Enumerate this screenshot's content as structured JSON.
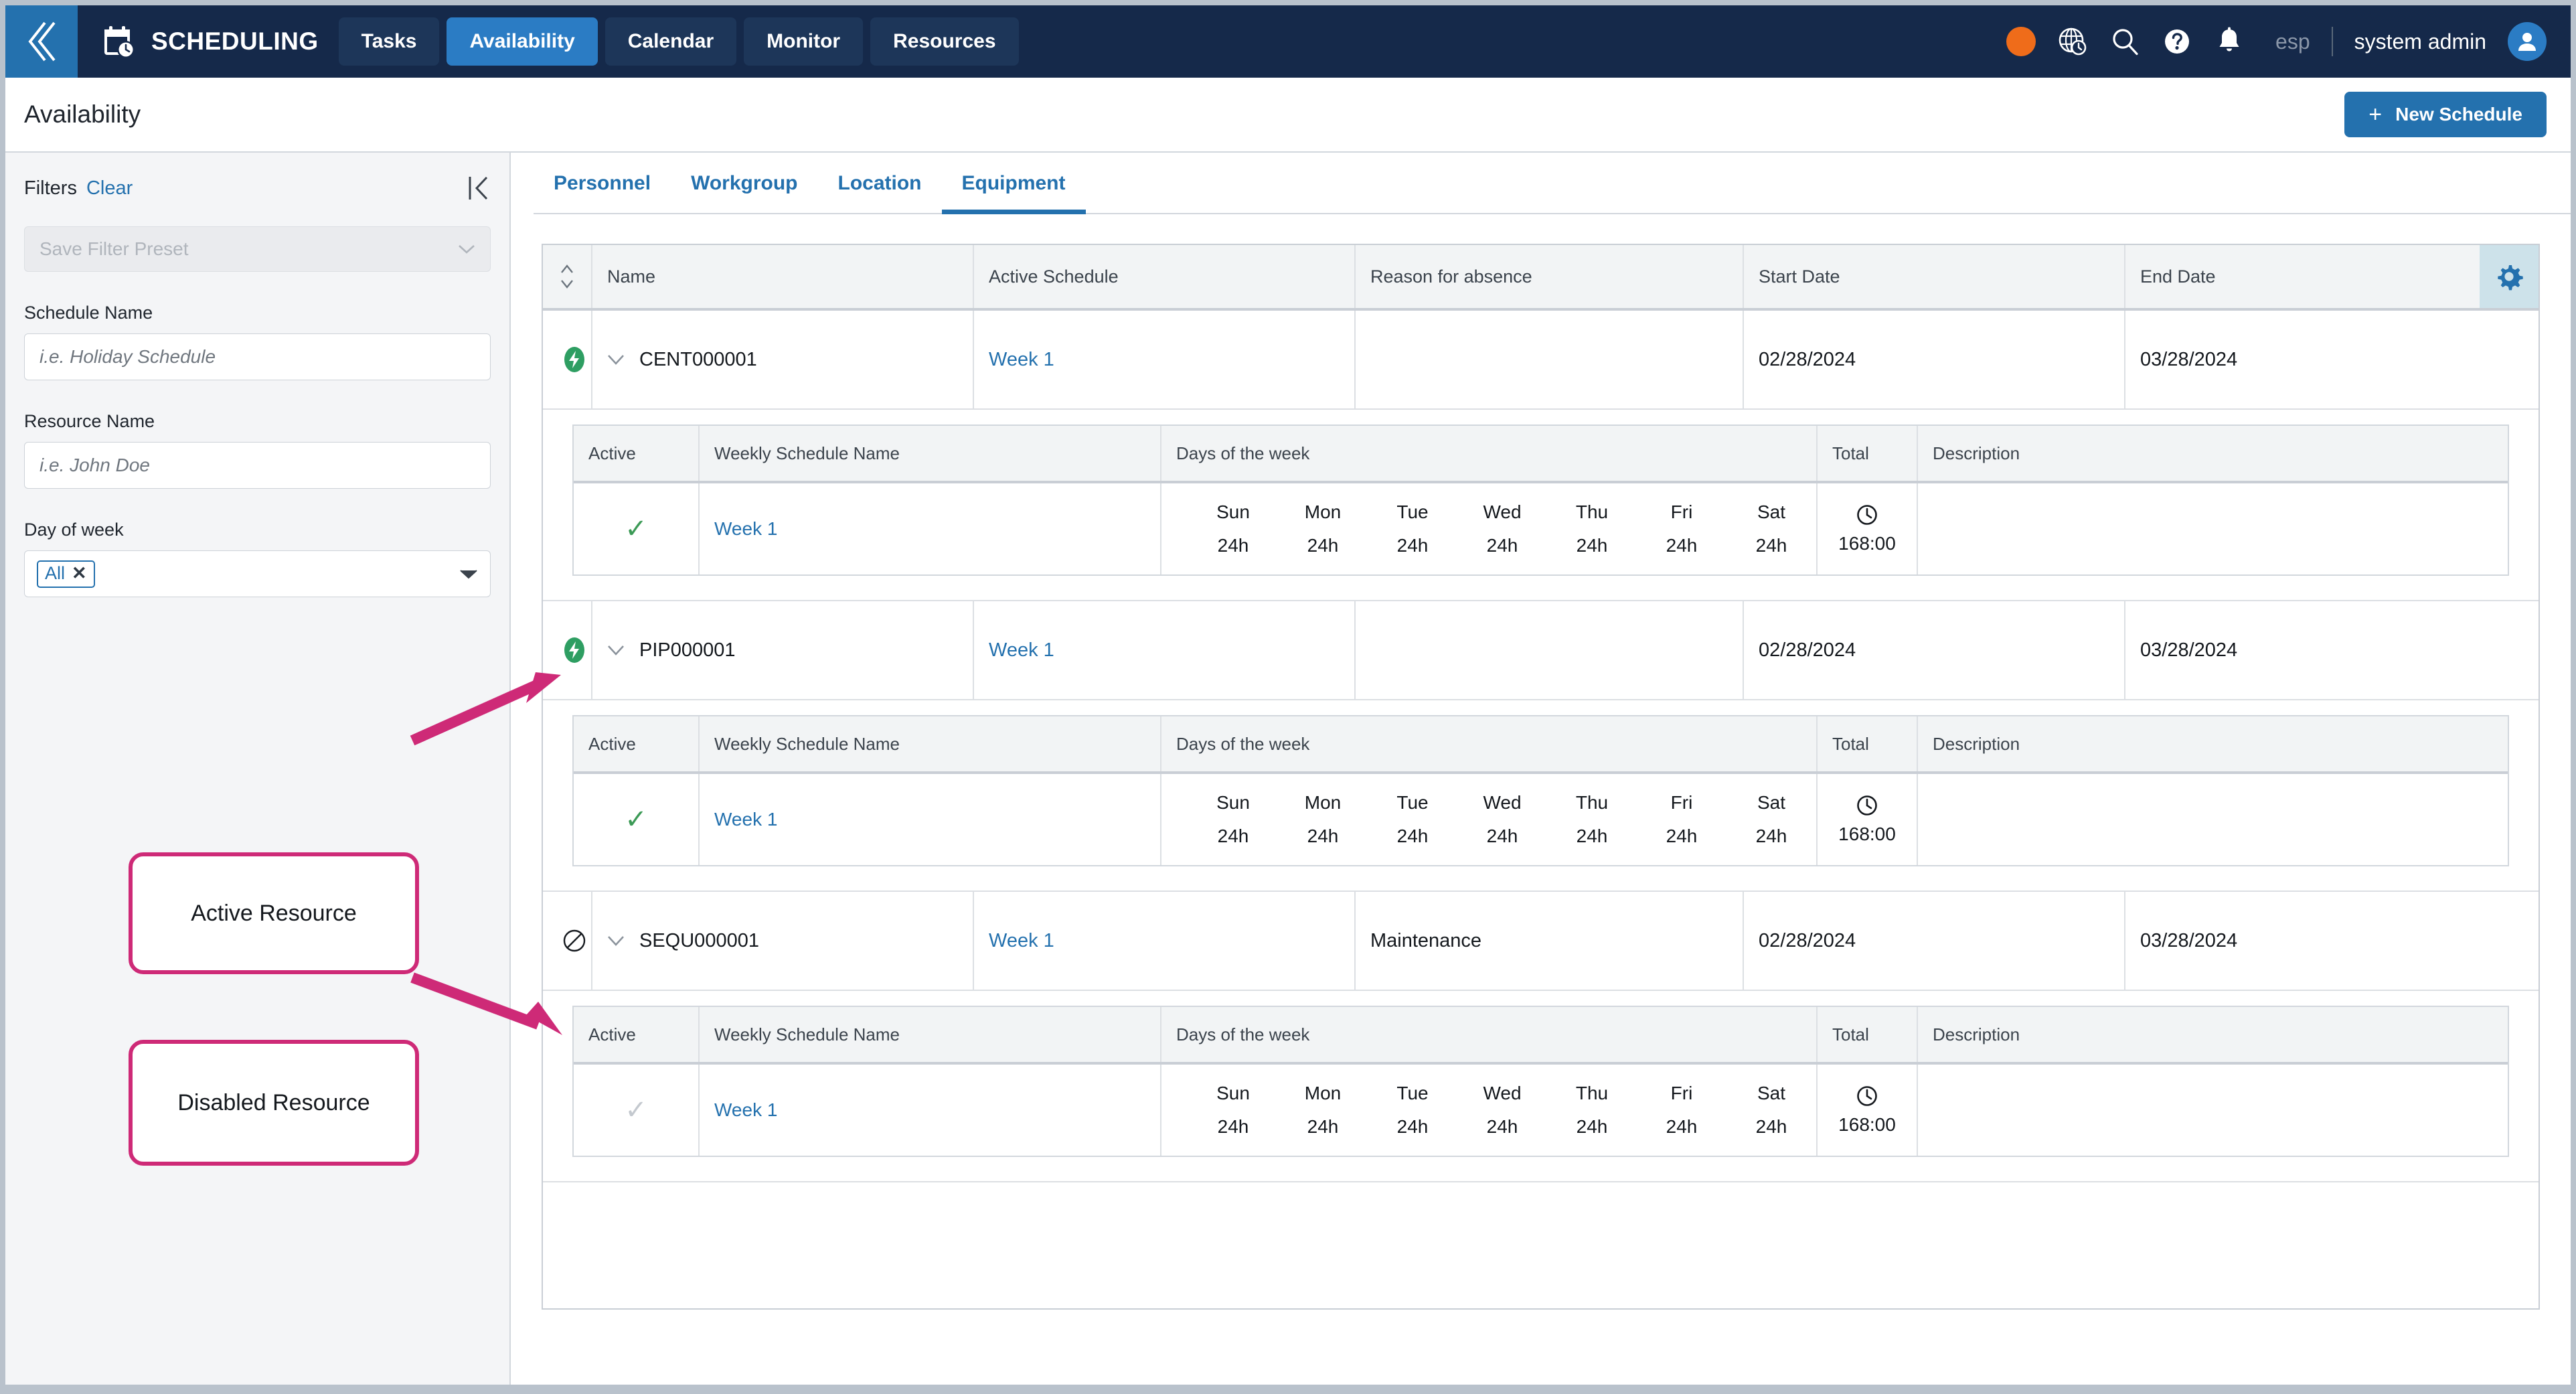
{
  "topnav": {
    "back_icon": "chevron-double-left-icon",
    "brand_icon": "calendar-clock-icon",
    "brand": "SCHEDULING",
    "tabs": [
      {
        "label": "Tasks",
        "active": false
      },
      {
        "label": "Availability",
        "active": true
      },
      {
        "label": "Calendar",
        "active": false
      },
      {
        "label": "Monitor",
        "active": false
      },
      {
        "label": "Resources",
        "active": false
      }
    ],
    "right": {
      "status_dot_color": "#ef6c1a",
      "icons": [
        "globe-clock-icon",
        "search-icon",
        "help-icon",
        "bell-icon"
      ],
      "locale": "esp",
      "user": "system admin",
      "avatar_icon": "user-avatar-icon"
    }
  },
  "header": {
    "title": "Availability",
    "new_schedule_label": "New Schedule",
    "new_schedule_plus": "+"
  },
  "sidebar": {
    "filters_label": "Filters",
    "clear_label": "Clear",
    "collapse_icon": "collapse-left-icon",
    "preset_placeholder": "Save Filter Preset",
    "fields": [
      {
        "label": "Schedule Name",
        "placeholder": "i.e. Holiday Schedule",
        "value": ""
      },
      {
        "label": "Resource Name",
        "placeholder": "i.e. John Doe",
        "value": ""
      }
    ],
    "day_of_week": {
      "label": "Day of week",
      "chip": "All",
      "chip_remove": "✕"
    }
  },
  "callouts": [
    {
      "text": "Active Resource",
      "color": "#ce2a77"
    },
    {
      "text": "Disabled Resource",
      "color": "#ce2a77"
    }
  ],
  "tabs": [
    {
      "label": "Personnel",
      "active": false
    },
    {
      "label": "Workgroup",
      "active": false
    },
    {
      "label": "Location",
      "active": false
    },
    {
      "label": "Equipment",
      "active": true
    }
  ],
  "table": {
    "columns": [
      "Name",
      "Active Schedule",
      "Reason for absence",
      "Start Date",
      "End Date"
    ],
    "sort_icon": "sort-updown-icon",
    "settings_icon": "gear-icon",
    "sub_columns": [
      "Active",
      "Weekly Schedule Name",
      "Days of the week",
      "Total",
      "Description"
    ],
    "day_labels": [
      "Sun",
      "Mon",
      "Tue",
      "Wed",
      "Thu",
      "Fri",
      "Sat"
    ],
    "rows": [
      {
        "status": "active",
        "status_icon": "bolt-circle-icon",
        "caret_icon": "chevron-down-icon",
        "name": "CENT000001",
        "active_schedule": "Week 1",
        "reason": "",
        "start_date": "02/28/2024",
        "end_date": "03/28/2024",
        "sub": {
          "active_check": "✓",
          "active_enabled": true,
          "weekly_schedule_name": "Week 1",
          "hours": [
            "24h",
            "24h",
            "24h",
            "24h",
            "24h",
            "24h",
            "24h"
          ],
          "total_icon": "clock-icon",
          "total": "168:00",
          "description": ""
        }
      },
      {
        "status": "active",
        "status_icon": "bolt-circle-icon",
        "caret_icon": "chevron-down-icon",
        "name": "PIP000001",
        "active_schedule": "Week 1",
        "reason": "",
        "start_date": "02/28/2024",
        "end_date": "03/28/2024",
        "sub": {
          "active_check": "✓",
          "active_enabled": true,
          "weekly_schedule_name": "Week 1",
          "hours": [
            "24h",
            "24h",
            "24h",
            "24h",
            "24h",
            "24h",
            "24h"
          ],
          "total_icon": "clock-icon",
          "total": "168:00",
          "description": ""
        }
      },
      {
        "status": "disabled",
        "status_icon": "no-entry-icon",
        "caret_icon": "chevron-down-icon",
        "name": "SEQU000001",
        "active_schedule": "Week 1",
        "reason": "Maintenance",
        "start_date": "02/28/2024",
        "end_date": "03/28/2024",
        "sub": {
          "active_check": "✓",
          "active_enabled": false,
          "weekly_schedule_name": "Week 1",
          "hours": [
            "24h",
            "24h",
            "24h",
            "24h",
            "24h",
            "24h",
            "24h"
          ],
          "total_icon": "clock-icon",
          "total": "168:00",
          "description": ""
        }
      }
    ]
  },
  "colors": {
    "navy": "#15294a",
    "accent_blue": "#2471ae",
    "active_tab_blue": "#2b7cc4",
    "callout_pink": "#ce2a77",
    "status_green": "#2e9e62",
    "status_orange": "#ef6c1a",
    "gear_bg": "#cde2ea"
  }
}
